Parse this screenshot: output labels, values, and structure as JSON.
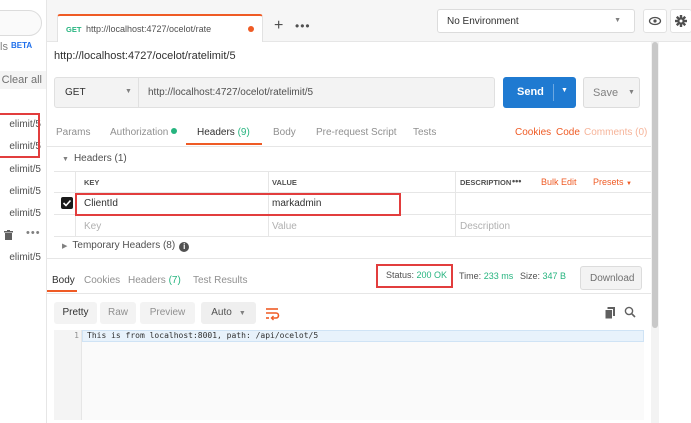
{
  "sidebar": {
    "beta_label": "ls",
    "beta_badge": "BETA",
    "clear_all": "Clear all",
    "history": [
      {
        "label": "elimit/5"
      },
      {
        "label": "elimit/5"
      },
      {
        "label": "elimit/5"
      },
      {
        "label": "elimit/5"
      },
      {
        "label": "elimit/5"
      },
      {
        "label": "elimit/5"
      }
    ],
    "more": "•••"
  },
  "tabbar": {
    "tab": {
      "method": "GET",
      "url": "http://localhost:4727/ocelot/rate"
    },
    "add": "+",
    "more": "•••",
    "environment": "No Environment"
  },
  "request": {
    "name": "http://localhost:4727/ocelot/ratelimit/5",
    "method": "GET",
    "url": "http://localhost:4727/ocelot/ratelimit/5",
    "send_label": "Send",
    "save_label": "Save"
  },
  "request_tabs": {
    "params": "Params",
    "authorization": "Authorization",
    "headers": "Headers",
    "headers_count": "(9)",
    "body": "Body",
    "prerequest": "Pre-request Script",
    "tests": "Tests",
    "cookies": "Cookies",
    "code": "Code",
    "comments": "Comments (0)"
  },
  "headers_section": {
    "title": "Headers (1)",
    "columns": {
      "key": "KEY",
      "value": "VALUE",
      "description": "DESCRIPTION",
      "more": "•••",
      "bulk_edit": "Bulk Edit",
      "presets": "Presets"
    },
    "rows": [
      {
        "key": "ClientId",
        "value": "markadmin",
        "description": "",
        "checked": true
      }
    ],
    "placeholder": {
      "key": "Key",
      "value": "Value",
      "description": "Description"
    },
    "temporary": "Temporary Headers (8)"
  },
  "response_tabs": {
    "body": "Body",
    "cookies": "Cookies",
    "headers": "Headers",
    "headers_count": "(7)",
    "test_results": "Test Results"
  },
  "response_meta": {
    "status_label": "Status:",
    "status_value": "200 OK",
    "time_label": "Time:",
    "time_value": "233 ms",
    "size_label": "Size:",
    "size_value": "347 B",
    "download": "Download"
  },
  "format_bar": {
    "pretty": "Pretty",
    "raw": "Raw",
    "preview": "Preview",
    "auto": "Auto"
  },
  "response_body": {
    "line_number": "1",
    "text": "This is from localhost:8001, path: /api/ocelot/5"
  },
  "colors": {
    "accent": "#ef5b25",
    "send": "#1f7ad1",
    "ok_green": "#26b47f",
    "highlight_red": "#e23d3d"
  }
}
